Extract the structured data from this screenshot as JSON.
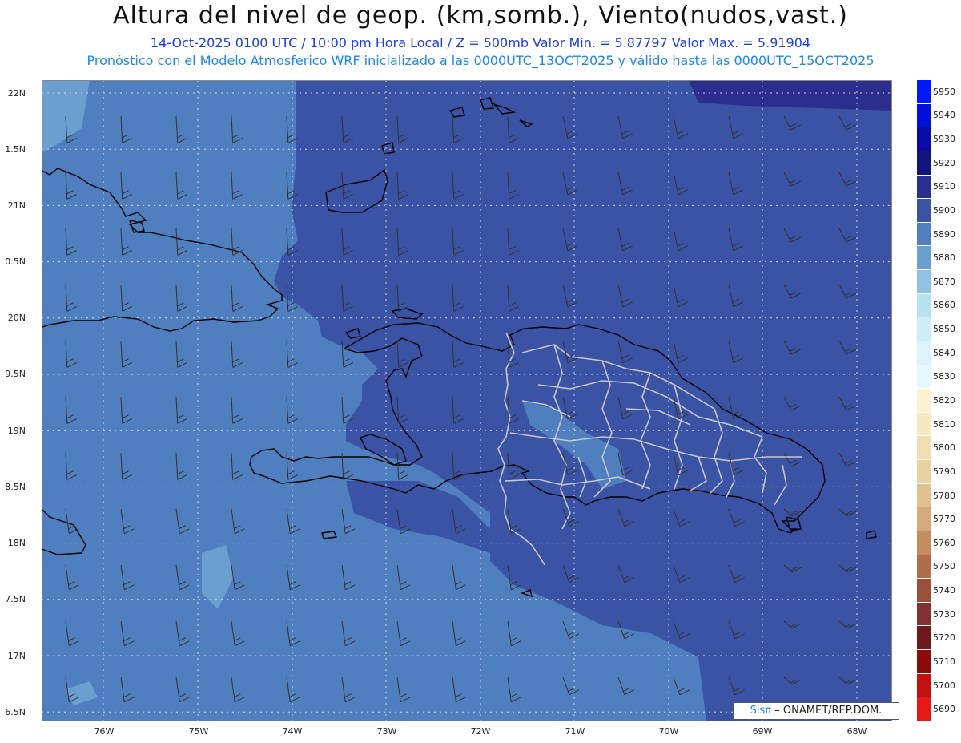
{
  "header": {
    "title": "Altura del nivel de geop. (km,somb.), Viento(nudos,vast.)",
    "subtitle": "14-Oct-2025  0100 UTC / 10:00 pm Hora Local / Z = 500mb   Valor Min. = 5.87797  Valor Max. = 5.91904",
    "model_line": "Pronóstico con el Modelo Atmosferico WRF inicializado a las 0000UTC_13OCT2025 y válido hasta las  0000UTC_15OCT2025"
  },
  "map": {
    "lat_labels": [
      "22N",
      "1.5N",
      "21N",
      "0.5N",
      "20N",
      "9.5N",
      "19N",
      "8.5N",
      "18N",
      "7.5N",
      "17N",
      "6.5N"
    ],
    "lon_labels": [
      "76W",
      "75W",
      "74W",
      "73W",
      "72W",
      "71W",
      "70W",
      "69W",
      "68W"
    ],
    "credit_sis": "Sisπ",
    "credit_text": "– ONAMET/REP.DOM."
  },
  "colorbar": {
    "labels": [
      "5950",
      "5940",
      "5930",
      "5920",
      "5910",
      "5900",
      "5890",
      "5880",
      "5870",
      "5860",
      "5850",
      "5840",
      "5830",
      "5820",
      "5810",
      "5800",
      "5790",
      "5780",
      "5770",
      "5760",
      "5750",
      "5740",
      "5730",
      "5720",
      "5710",
      "5700",
      "5690"
    ],
    "colors": [
      "#0019ff",
      "#0010d8",
      "#0a0aa8",
      "#14147e",
      "#2b2e8c",
      "#3a53a4",
      "#4f7fbe",
      "#6b9fd0",
      "#90c2e4",
      "#b8e2f0",
      "#cdeef6",
      "#dcf4f9",
      "#e6f8fb",
      "#fbf3cf",
      "#f6e9bf",
      "#f1deb0",
      "#ead2a0",
      "#e2c28c",
      "#d5a97a",
      "#c48d5e",
      "#b06e48",
      "#98503a",
      "#833030",
      "#6e1a1a",
      "#8a0c0c",
      "#c41010",
      "#e81818"
    ]
  },
  "colors": {
    "field_low": "#4f7fbe",
    "field_mid": "#3a53a4",
    "field_high": "#2b2e8c",
    "field_pale": "#6b9fd0",
    "coast": "#000000",
    "provinces": "#c8c8c8"
  }
}
